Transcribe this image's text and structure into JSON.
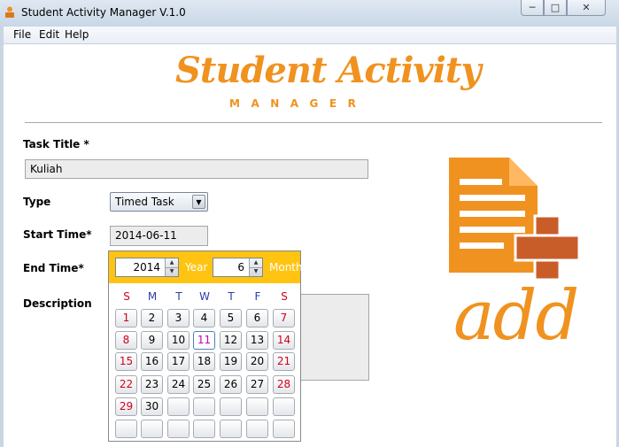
{
  "window": {
    "title": "Student Activity Manager V.1.0"
  },
  "menu": [
    "File",
    "Edit",
    "Help"
  ],
  "logo": {
    "main": "Student Activity",
    "sub": "MANAGER"
  },
  "form": {
    "task_title_label": "Task Title *",
    "task_title_value": "Kuliah",
    "type_label": "Type",
    "type_value": "Timed Task",
    "start_time_label": "Start Time*",
    "start_time_value": "2014-06-11",
    "end_time_label": "End Time*",
    "description_label": "Description"
  },
  "calendar": {
    "year": "2014",
    "year_label": "Year",
    "month": "6",
    "month_label": "Month",
    "weekdays": [
      "S",
      "M",
      "T",
      "W",
      "T",
      "F",
      "S"
    ],
    "days": [
      [
        "1",
        "2",
        "3",
        "4",
        "5",
        "6",
        "7"
      ],
      [
        "8",
        "9",
        "10",
        "11",
        "12",
        "13",
        "14"
      ],
      [
        "15",
        "16",
        "17",
        "18",
        "19",
        "20",
        "21"
      ],
      [
        "22",
        "23",
        "24",
        "25",
        "26",
        "27",
        "28"
      ],
      [
        "29",
        "30",
        "",
        "",
        "",
        "",
        ""
      ],
      [
        "",
        "",
        "",
        "",
        "",
        "",
        ""
      ]
    ],
    "selected_day": "11"
  },
  "add_graphic": {
    "text": "add"
  },
  "colors": {
    "accent": "#f0921f",
    "calendar_header": "#ffc411",
    "weekend": "#d0021b",
    "weekday_header": "#2a3fa8"
  },
  "icons": {
    "app": "app-icon",
    "minimize": "minimize-icon",
    "maximize": "maximize-icon",
    "close": "close-icon",
    "add_document": "add-document-icon"
  }
}
